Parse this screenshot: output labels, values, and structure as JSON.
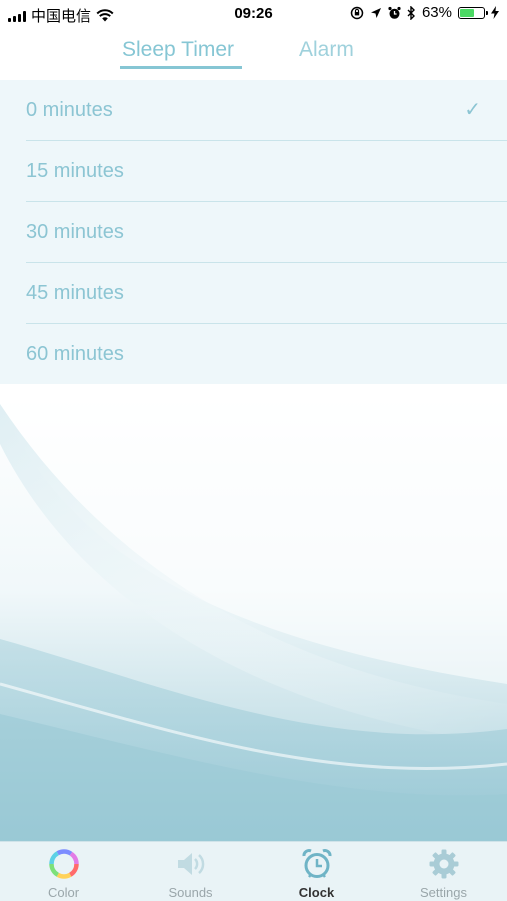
{
  "status_bar": {
    "carrier": "中国电信",
    "time": "09:26",
    "battery_percent": "63%",
    "battery_level": 0.63
  },
  "tabs": {
    "sleep_timer": "Sleep Timer",
    "alarm": "Alarm",
    "active": "sleep_timer"
  },
  "options": [
    {
      "label": "0 minutes",
      "selected": true
    },
    {
      "label": "15 minutes",
      "selected": false
    },
    {
      "label": "30 minutes",
      "selected": false
    },
    {
      "label": "45 minutes",
      "selected": false
    },
    {
      "label": "60 minutes",
      "selected": false
    }
  ],
  "check_mark": "✓",
  "tabbar": {
    "items": [
      {
        "label": "Color",
        "icon": "color-wheel-icon"
      },
      {
        "label": "Sounds",
        "icon": "speaker-icon"
      },
      {
        "label": "Clock",
        "icon": "alarm-clock-icon"
      },
      {
        "label": "Settings",
        "icon": "gear-icon"
      }
    ],
    "active": "Clock"
  },
  "colors": {
    "accent": "#86c6d4",
    "list_bg": "#eef7fa",
    "divider": "#c9e4ea",
    "tabbar_bg": "#e9f3f6"
  }
}
